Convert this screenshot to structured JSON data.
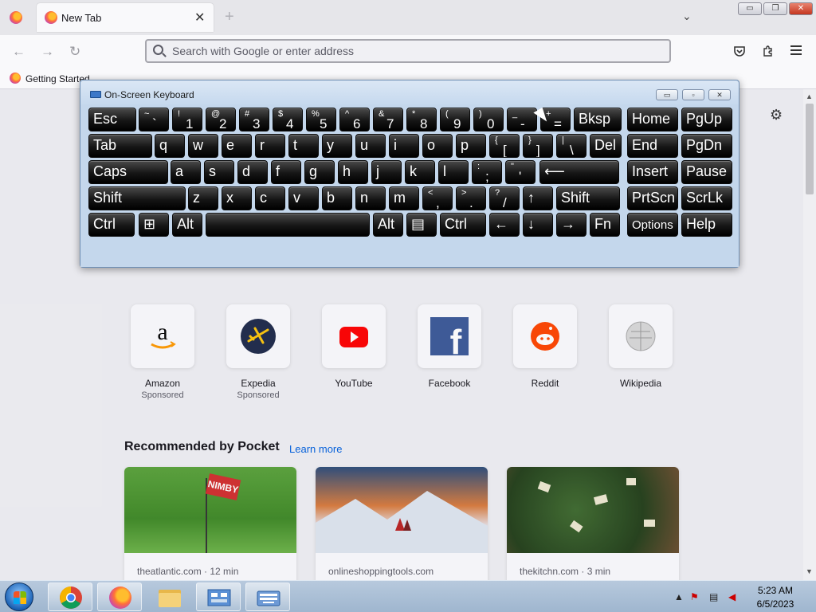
{
  "browser": {
    "tab_title": "New Tab",
    "tab_close": "✕",
    "new_tab": "+",
    "tab_list": "⌄",
    "search_placeholder": "Search with Google or enter address",
    "back": "←",
    "forward": "→",
    "reload": "↻",
    "bookmark_label": "Getting Started",
    "window_min": "▭",
    "window_max": "❐",
    "window_close": "✕"
  },
  "newtab": {
    "gear": "⚙",
    "top_sites": [
      {
        "name": "Amazon",
        "sponsor": "Sponsored",
        "icon": "amazon-icon"
      },
      {
        "name": "Expedia",
        "sponsor": "Sponsored",
        "icon": "expedia-icon"
      },
      {
        "name": "YouTube",
        "sponsor": "",
        "icon": "youtube-icon"
      },
      {
        "name": "Facebook",
        "sponsor": "",
        "icon": "facebook-icon"
      },
      {
        "name": "Reddit",
        "sponsor": "",
        "icon": "reddit-icon"
      },
      {
        "name": "Wikipedia",
        "sponsor": "",
        "icon": "wikipedia-icon"
      }
    ],
    "pocket_title": "Recommended by Pocket",
    "pocket_learn_more": "Learn more",
    "cards": [
      {
        "source": "theatlantic.com · 12 min",
        "flag_text": "NIMBY"
      },
      {
        "source": "onlineshoppingtools.com"
      },
      {
        "source": "thekitchn.com · 3 min"
      }
    ]
  },
  "osk": {
    "title": "On-Screen Keyboard",
    "min": "▭",
    "max": "▫",
    "close": "✕",
    "row1": [
      {
        "main": "Esc"
      },
      {
        "shift": "~",
        "low": "`"
      },
      {
        "shift": "!",
        "low": "1"
      },
      {
        "shift": "@",
        "low": "2"
      },
      {
        "shift": "#",
        "low": "3"
      },
      {
        "shift": "$",
        "low": "4"
      },
      {
        "shift": "%",
        "low": "5"
      },
      {
        "shift": "^",
        "low": "6"
      },
      {
        "shift": "&",
        "low": "7"
      },
      {
        "shift": "*",
        "low": "8"
      },
      {
        "shift": "(",
        "low": "9"
      },
      {
        "shift": ")",
        "low": "0"
      },
      {
        "shift": "_",
        "low": "-"
      },
      {
        "shift": "+",
        "low": "="
      },
      {
        "main": "Bksp"
      },
      {
        "main": "Home"
      },
      {
        "main": "PgUp"
      }
    ],
    "row2": [
      {
        "main": "Tab"
      },
      {
        "main": "q"
      },
      {
        "main": "w"
      },
      {
        "main": "e"
      },
      {
        "main": "r"
      },
      {
        "main": "t"
      },
      {
        "main": "y"
      },
      {
        "main": "u"
      },
      {
        "main": "i"
      },
      {
        "main": "o"
      },
      {
        "main": "p"
      },
      {
        "shift": "{",
        "low": "["
      },
      {
        "shift": "}",
        "low": "]"
      },
      {
        "shift": "|",
        "low": "\\"
      },
      {
        "main": "Del"
      },
      {
        "main": "End"
      },
      {
        "main": "PgDn"
      }
    ],
    "row3": [
      {
        "main": "Caps"
      },
      {
        "main": "a"
      },
      {
        "main": "s"
      },
      {
        "main": "d"
      },
      {
        "main": "f"
      },
      {
        "main": "g"
      },
      {
        "main": "h"
      },
      {
        "main": "j"
      },
      {
        "main": "k"
      },
      {
        "main": "l"
      },
      {
        "shift": ":",
        "low": ";"
      },
      {
        "shift": "\"",
        "low": "'"
      },
      {
        "main": "⟵"
      },
      {
        "main": "Insert"
      },
      {
        "main": "Pause"
      }
    ],
    "row4": [
      {
        "main": "Shift"
      },
      {
        "main": "z"
      },
      {
        "main": "x"
      },
      {
        "main": "c"
      },
      {
        "main": "v"
      },
      {
        "main": "b"
      },
      {
        "main": "n"
      },
      {
        "main": "m"
      },
      {
        "shift": "<",
        "low": ","
      },
      {
        "shift": ">",
        "low": "."
      },
      {
        "shift": "?",
        "low": "/"
      },
      {
        "main": "↑"
      },
      {
        "main": "Shift"
      },
      {
        "main": "PrtScn"
      },
      {
        "main": "ScrLk"
      }
    ],
    "row5": [
      {
        "main": "Ctrl"
      },
      {
        "main": "⊞"
      },
      {
        "main": "Alt"
      },
      {
        "main": ""
      },
      {
        "main": "Alt"
      },
      {
        "main": "▤"
      },
      {
        "main": "Ctrl"
      },
      {
        "main": "←"
      },
      {
        "main": "↓"
      },
      {
        "main": "→"
      },
      {
        "main": "Fn"
      },
      {
        "main": "Options"
      },
      {
        "main": "Help"
      }
    ]
  },
  "taskbar": {
    "time": "5:23 AM",
    "date": "6/5/2023",
    "tray_arrow": "▲"
  }
}
